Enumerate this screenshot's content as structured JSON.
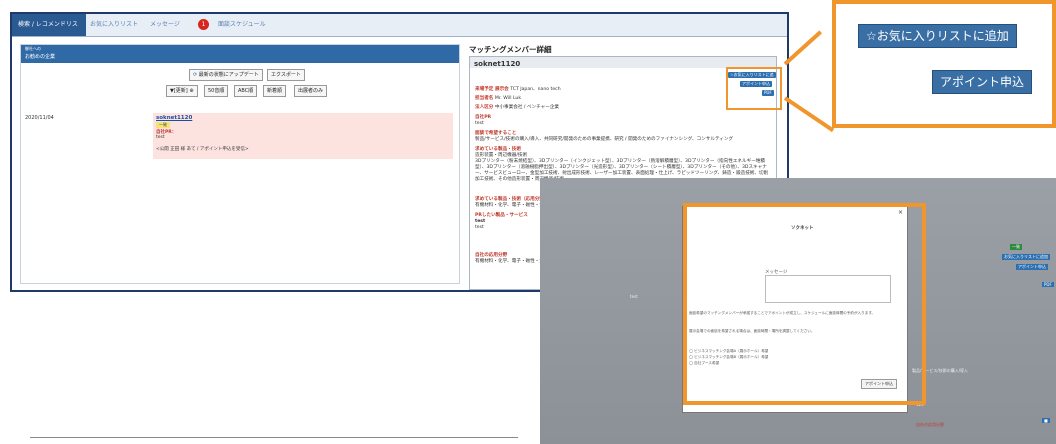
{
  "tabs": [
    {
      "label": "検索 / レコメンドリスト"
    },
    {
      "label": "お気に入りリスト"
    },
    {
      "label": "メッセージ"
    },
    {
      "label": "面談スケジュール"
    }
  ],
  "notification_count": "1",
  "left_panel": {
    "heading_small": "御社への",
    "heading": "お勧めの企業",
    "update_button": "最新の状態にアップデート",
    "export_button": "エクスポート",
    "sort_buttons": [
      "▼[更新] ⊕",
      "50音順",
      "ABC順",
      "新着順",
      "出展者のみ"
    ],
    "entry": {
      "date": "2020/11/04",
      "name": "soknet1120",
      "badge": "一致",
      "pr_label": "自社PR：",
      "pr_value": "test",
      "note": "<公開 正田 様 あて / アポイント申込を受信>"
    }
  },
  "right_panel": {
    "title": "マッチングメンバー詳細",
    "member_name": "soknet1120",
    "btn_favorite": "☆お気に入りリストに追加",
    "btn_appoint": "アポイント申込",
    "btn_pdf": "PDF",
    "fields": [
      {
        "label": "来場予定 展示会",
        "value": "TCT Japan、nano tech"
      },
      {
        "label": "担当者名",
        "value": "Mr. Will Luk"
      },
      {
        "label": "法人区分",
        "value": "中小事業会社 / ベンチャー企業"
      },
      {
        "label": "自社PR",
        "value": "test"
      },
      {
        "label": "面談で希望すること",
        "value": "製品/サービス/技術の購入/導入、共同研究/開発のための事業提携、研究 / 開発のためのファイナンシング、コンサルティング"
      },
      {
        "label": "求めている製品・技術",
        "value": "造形装置・周辺機器/技術"
      },
      {
        "label": "",
        "value": "3Dプリンター（粉末焼結型）、3Dプリンター（インクジェット型）、3Dプリンター（熱溶解積層型）、3Dプリンター（指向性エネルギー堆積型）、3Dプリンター（溶融樹脂押出型）、3Dプリンター（光造形型）、3Dプリンター（シート積層型）、3Dプリンター（その他）、3Dスキャナー、サービスビューロー、金型加工技術、射出成形技術、レーザー加工装置、表面処理・仕上げ、ラピッドツーリング、鋳造・鍛造技術、切削加工技術、その他造形装置・周辺機器/技術"
      },
      {
        "label": "求めている製品・技術（応用分野）",
        "value": "有機材料・化学、電子・磁性・金属・無機材料、半導体・電子部品"
      },
      {
        "label": "PRしたい製品・サービス",
        "value": "test"
      },
      {
        "label": "",
        "value": "test"
      },
      {
        "label": "自社の応用分野",
        "value": "有機材料・化学、電子・磁性・金属・無機材料、半導体・電子部品"
      }
    ],
    "btn_more": "詳細表"
  },
  "zoom": {
    "btn_favorite": "☆お気に入りリストに追加",
    "btn_appoint": "アポイント申込"
  },
  "sub_screen": {
    "modal_title": "ソクネット",
    "close": "×",
    "message_label": "メッセージ",
    "notice1": "面談希望のマッチングメンバーが承諾することでアポイントが成立し、スケジュールに面談時間の予約が入ります。",
    "notice2": "展示会場での面談を希望される場合は、面談時間・場所を調整してください。",
    "options": [
      "ビジネスマッチング会場A（展示ホール）希望",
      "ビジネスマッチング会場B（展示ホール）希望",
      "自社ブース希望"
    ],
    "submit_button": "アポイント申込",
    "bg_labels": [
      "お気に入りリストに追加",
      "アポイント申込",
      "PDF",
      "製品/サービス/技術の購入/導入",
      "test",
      "123",
      "自社の応用分野"
    ]
  },
  "colors": {
    "accent": "#f1962c",
    "primary_blue": "#2f6aa6",
    "tab_blue": "#2a5a92",
    "entry_bg": "#fde3e0"
  }
}
